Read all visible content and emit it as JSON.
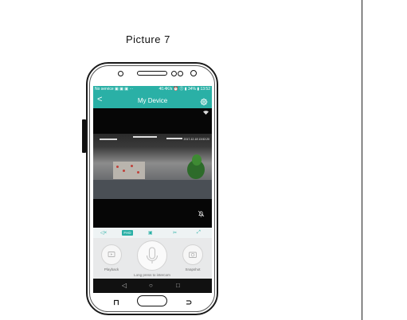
{
  "caption": "Picture 7",
  "status_bar": {
    "left": "No service ▣ ▣ ▣ ···",
    "right": "40.4K/s ⏰ ⓵ ▮ 34% ▮ 13:52"
  },
  "app": {
    "back_glyph": "<",
    "title": "My Device"
  },
  "video": {
    "osd_timestamp": "2017-12-18 13:52:20"
  },
  "controls": {
    "mute_glyph": "◁×",
    "hd_label": "FHD",
    "screen_glyph": "▣",
    "cut_glyph": "✂",
    "fullscreen_glyph": "⤢"
  },
  "actions": {
    "playback_label": "Playback",
    "snapshot_label": "Snapshot",
    "intercom_label": "Long press to intercom"
  },
  "navbar": {
    "back": "◁",
    "home": "○",
    "recent": "□"
  },
  "hardware": {
    "left_key": "⊓",
    "right_key": "⊃"
  },
  "colors": {
    "accent": "#2ab0a6",
    "panel": "#e8e9ea",
    "nav": "#111111"
  }
}
